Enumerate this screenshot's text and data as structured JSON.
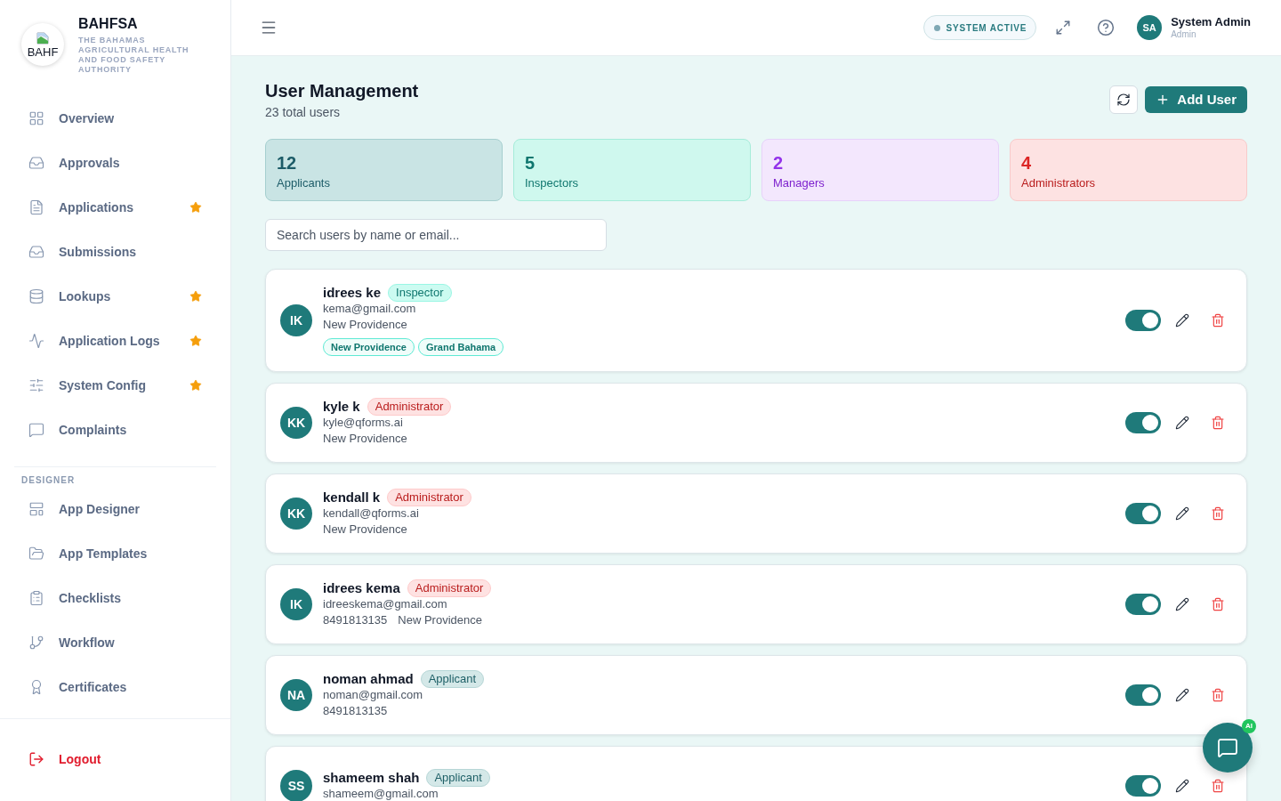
{
  "sidebar": {
    "brand": {
      "logo_alt": "BAHF",
      "name": "BAHFSA",
      "tagline": "THE BAHAMAS AGRICULTURAL HEALTH AND FOOD SAFETY AUTHORITY"
    },
    "nav_items": [
      {
        "label": "Overview",
        "selected": false,
        "starred": false
      },
      {
        "label": "Approvals",
        "selected": false,
        "starred": false
      },
      {
        "label": "Applications",
        "selected": false,
        "starred": true
      },
      {
        "label": "Submissions",
        "selected": false,
        "starred": false
      },
      {
        "label": "Lookups",
        "selected": false,
        "starred": true
      },
      {
        "label": "Application Logs",
        "selected": false,
        "starred": true
      },
      {
        "label": "System Config",
        "selected": false,
        "starred": true
      },
      {
        "label": "Complaints",
        "selected": false,
        "starred": false
      }
    ],
    "sections": [
      {
        "heading": "DESIGNER",
        "items": [
          {
            "label": "App Designer",
            "selected": false,
            "starred": false
          },
          {
            "label": "App Templates",
            "selected": false,
            "starred": false
          },
          {
            "label": "Checklists",
            "selected": false,
            "starred": false
          },
          {
            "label": "Workflow",
            "selected": false,
            "starred": false
          },
          {
            "label": "Certificates",
            "selected": false,
            "starred": false
          }
        ]
      }
    ],
    "logout": "Logout"
  },
  "header": {
    "status": "SYSTEM ACTIVE",
    "user": {
      "initials": "SA",
      "name": "System Admin",
      "role": "Admin"
    }
  },
  "page": {
    "title": "User Management",
    "subtitle": "23 total users",
    "add_button": "Add User"
  },
  "stats": [
    {
      "value": "12",
      "label": "Applicants",
      "kind": "applicant"
    },
    {
      "value": "5",
      "label": "Inspectors",
      "kind": "inspector"
    },
    {
      "value": "2",
      "label": "Managers",
      "kind": "manager"
    },
    {
      "value": "4",
      "label": "Administrators",
      "kind": "administrator"
    }
  ],
  "search": {
    "placeholder": "Search users by name or email..."
  },
  "users": [
    {
      "initials": "IK",
      "name": "idrees ke",
      "role": {
        "label": "Inspector",
        "kind": "inspector"
      },
      "email": "kema@gmail.com",
      "details": [
        "New Providence"
      ],
      "regions": [
        "New Providence",
        "Grand Bahama"
      ],
      "active": true
    },
    {
      "initials": "KK",
      "name": "kyle k",
      "role": {
        "label": "Administrator",
        "kind": "administrator"
      },
      "email": "kyle@qforms.ai",
      "details": [
        "New Providence"
      ],
      "active": true
    },
    {
      "initials": "KK",
      "name": "kendall k",
      "role": {
        "label": "Administrator",
        "kind": "administrator"
      },
      "email": "kendall@qforms.ai",
      "details": [
        "New Providence"
      ],
      "active": true
    },
    {
      "initials": "IK",
      "name": "idrees kema",
      "role": {
        "label": "Administrator",
        "kind": "administrator"
      },
      "email": "idreeskema@gmail.com",
      "details": [
        "8491813135",
        "New Providence"
      ],
      "active": true
    },
    {
      "initials": "NA",
      "name": "noman ahmad",
      "role": {
        "label": "Applicant",
        "kind": "applicant"
      },
      "email": "noman@gmail.com",
      "details": [
        "8491813135"
      ],
      "active": true
    },
    {
      "initials": "SS",
      "name": "shameem shah",
      "role": {
        "label": "Applicant",
        "kind": "applicant"
      },
      "email": "shameem@gmail.com",
      "active": true
    }
  ],
  "chat_button": {
    "badge": "AI"
  }
}
